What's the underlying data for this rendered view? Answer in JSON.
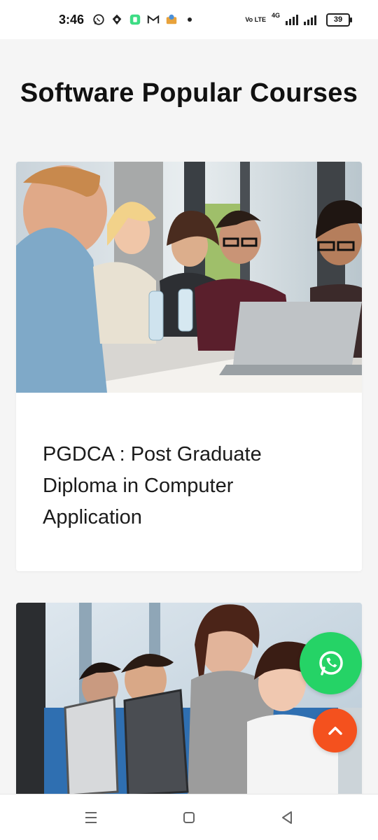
{
  "status_bar": {
    "time": "3:46",
    "network_type": "4G",
    "volte_label": "Vo LTE",
    "battery_level": "39",
    "notification_icons": [
      "whatsapp-icon",
      "threads-icon",
      "app-icon",
      "gmail-icon",
      "box-icon"
    ]
  },
  "page": {
    "title": "Software Popular Courses"
  },
  "courses": [
    {
      "title": "PGDCA : Post Graduate Diploma in Computer Application",
      "image": "students-with-laptop-photo"
    },
    {
      "title": "",
      "image": "students-at-computers-photo"
    }
  ],
  "floating_actions": {
    "whatsapp_icon": "whatsapp-icon",
    "scroll_top_icon": "chevron-up-icon",
    "whatsapp_color": "#25d366",
    "scroll_top_color": "#f4511e"
  },
  "nav_bar": {
    "icons": [
      "menu-icon",
      "home-icon",
      "back-icon"
    ]
  }
}
